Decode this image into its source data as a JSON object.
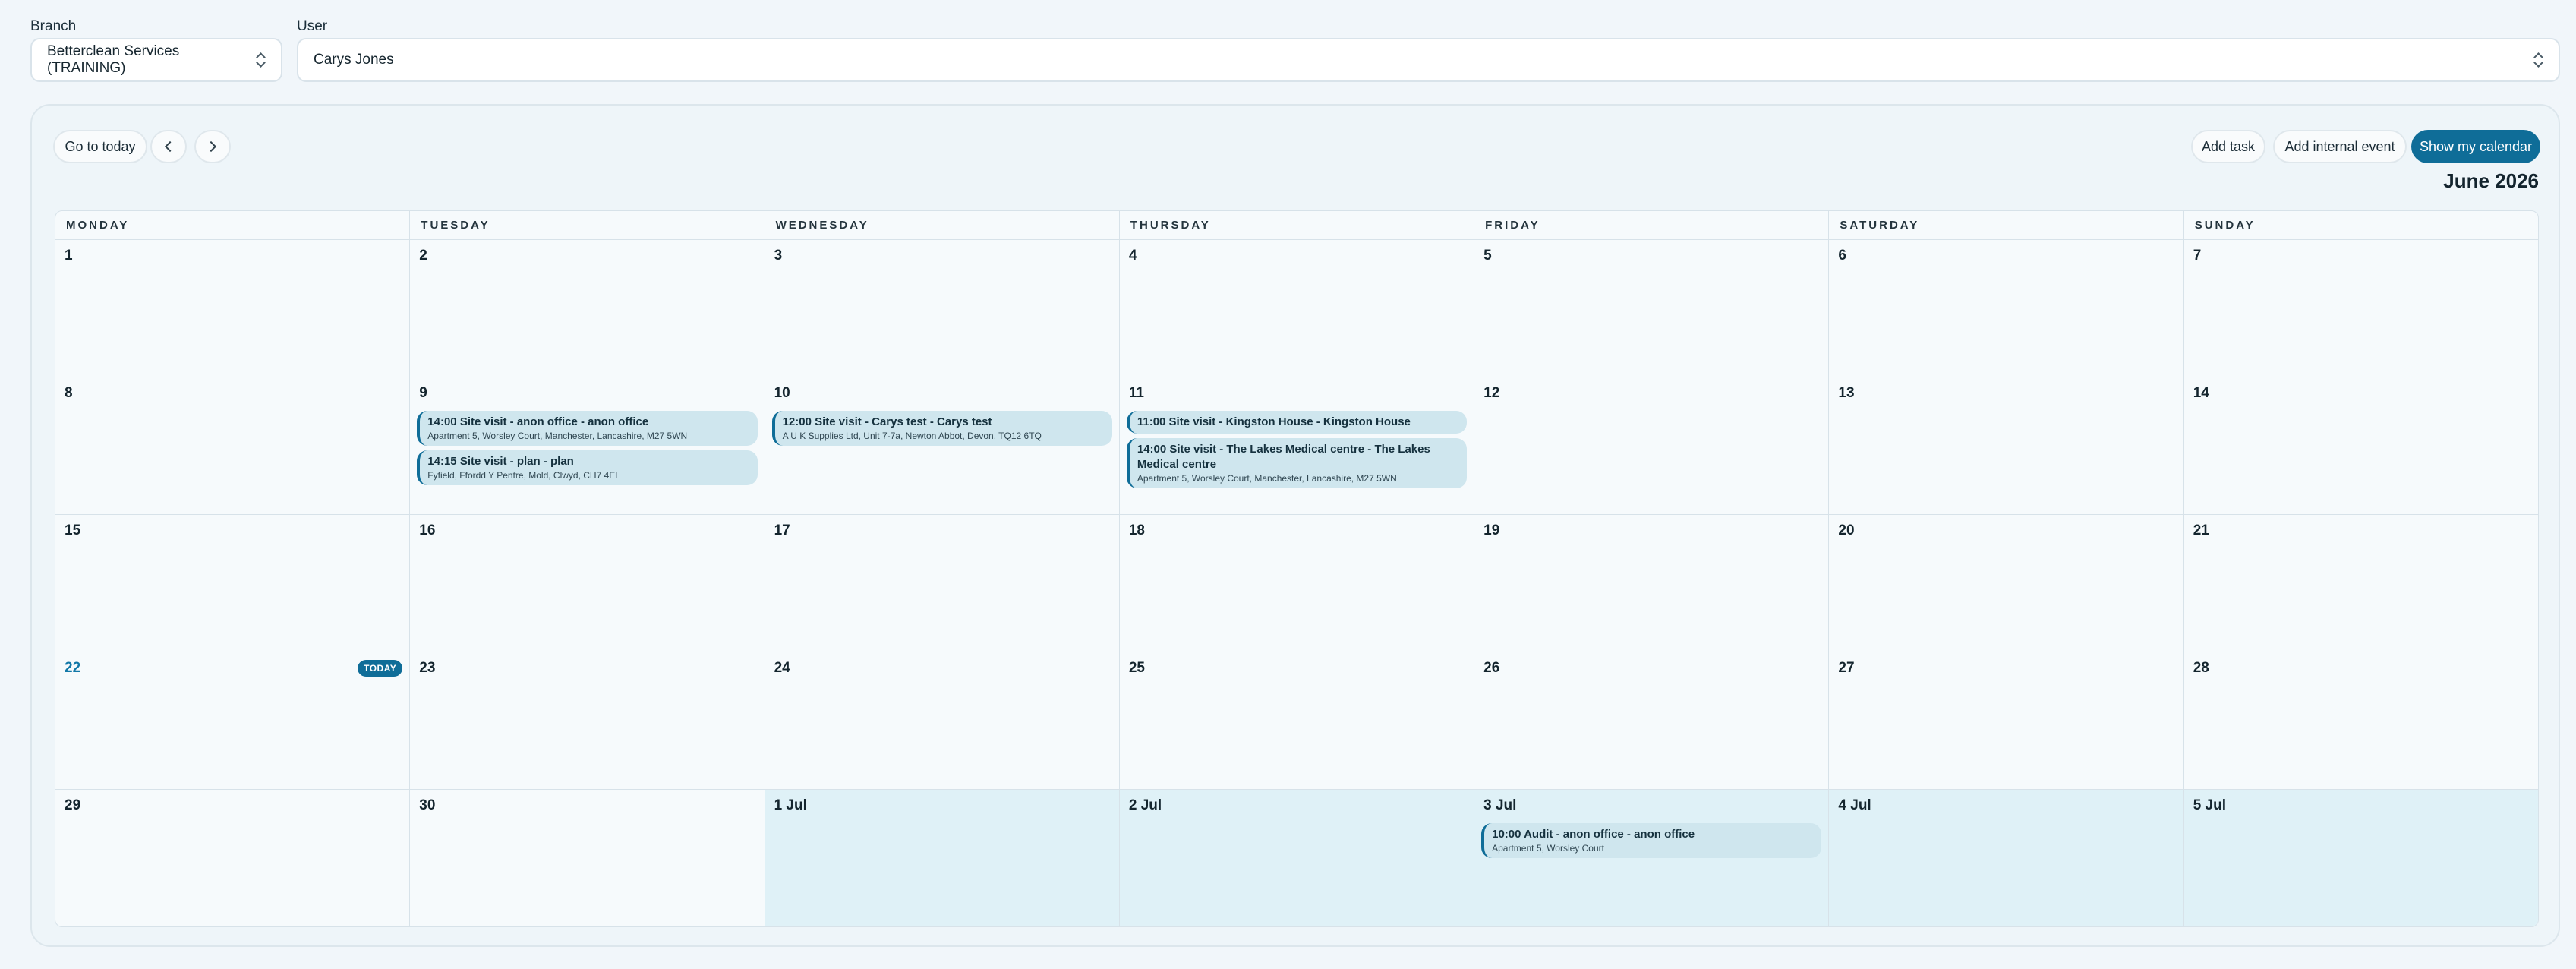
{
  "filters": {
    "branch_label": "Branch",
    "branch_value": "Betterclean Services (TRAINING)",
    "user_label": "User",
    "user_value": "Carys Jones"
  },
  "toolbar": {
    "go_today": "Go to today",
    "add_task": "Add task",
    "add_internal_event": "Add internal event",
    "show_my_calendar": "Show my calendar",
    "month_title": "June 2026"
  },
  "weekdays": [
    "MONDAY",
    "TUESDAY",
    "WEDNESDAY",
    "THURSDAY",
    "FRIDAY",
    "SATURDAY",
    "SUNDAY"
  ],
  "today_badge": "TODAY",
  "weeks": [
    [
      {
        "n": "1"
      },
      {
        "n": "2"
      },
      {
        "n": "3"
      },
      {
        "n": "4"
      },
      {
        "n": "5"
      },
      {
        "n": "6"
      },
      {
        "n": "7"
      }
    ],
    [
      {
        "n": "8"
      },
      {
        "n": "9",
        "events": [
          {
            "title": "14:00 Site visit - anon office - anon office",
            "addr": "Apartment 5, Worsley Court, Manchester, Lancashire, M27 5WN"
          },
          {
            "title": "14:15 Site visit - plan - plan",
            "addr": "Fyfield, Ffordd Y Pentre, Mold, Clwyd, CH7 4EL"
          }
        ]
      },
      {
        "n": "10",
        "events": [
          {
            "title": "12:00 Site visit - Carys test - Carys test",
            "addr": "A U K Supplies Ltd, Unit 7-7a, Newton Abbot, Devon, TQ12 6TQ"
          }
        ]
      },
      {
        "n": "11",
        "events": [
          {
            "title": "11:00 Site visit - Kingston House - Kingston House",
            "addr": ""
          },
          {
            "title": "14:00 Site visit - The Lakes Medical centre - The Lakes Medical centre",
            "addr": "Apartment 5, Worsley Court, Manchester, Lancashire, M27 5WN"
          }
        ]
      },
      {
        "n": "12"
      },
      {
        "n": "13"
      },
      {
        "n": "14"
      }
    ],
    [
      {
        "n": "15"
      },
      {
        "n": "16"
      },
      {
        "n": "17"
      },
      {
        "n": "18"
      },
      {
        "n": "19"
      },
      {
        "n": "20"
      },
      {
        "n": "21"
      }
    ],
    [
      {
        "n": "22",
        "today": true
      },
      {
        "n": "23"
      },
      {
        "n": "24"
      },
      {
        "n": "25"
      },
      {
        "n": "26"
      },
      {
        "n": "27"
      },
      {
        "n": "28"
      }
    ],
    [
      {
        "n": "29"
      },
      {
        "n": "30"
      },
      {
        "n": "1 Jul",
        "next": true
      },
      {
        "n": "2 Jul",
        "next": true
      },
      {
        "n": "3 Jul",
        "next": true,
        "events": [
          {
            "title": "10:00 Audit - anon office - anon office",
            "addr": "Apartment 5, Worsley Court"
          }
        ]
      },
      {
        "n": "4 Jul",
        "next": true
      },
      {
        "n": "5 Jul",
        "next": true
      }
    ]
  ],
  "colors": {
    "accent": "#0f6d98",
    "next_month_bg": "#dff1f7",
    "event_bg": "#cfe6ee"
  }
}
